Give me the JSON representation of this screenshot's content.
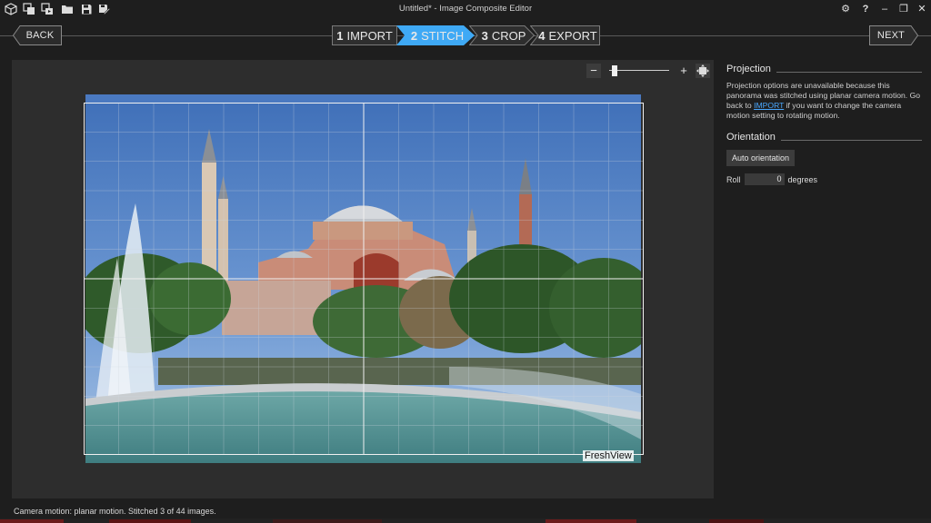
{
  "window": {
    "title": "Untitled* - Image Composite Editor",
    "toolbar_icons": [
      "new-panorama-icon",
      "new-from-images-icon",
      "new-from-video-icon",
      "open-icon",
      "save-icon",
      "save-as-icon"
    ],
    "controls": {
      "settings_icon": "⚙",
      "help": "?",
      "minimize": "–",
      "restore": "❐",
      "close": "✕"
    }
  },
  "nav": {
    "back_label": "BACK",
    "next_label": "NEXT"
  },
  "steps": [
    {
      "num": "1",
      "label": "IMPORT",
      "active": false
    },
    {
      "num": "2",
      "label": "STITCH",
      "active": true
    },
    {
      "num": "3",
      "label": "CROP",
      "active": false
    },
    {
      "num": "4",
      "label": "EXPORT",
      "active": false
    }
  ],
  "zoom": {
    "minus": "−",
    "plus": "+",
    "fit_icon": "fit-to-window-icon",
    "level_fraction": 0.05
  },
  "preview": {
    "watermark": "FreshView"
  },
  "panel": {
    "projection": {
      "heading": "Projection",
      "text_before_link": "Projection options are unavailable because this panorama was stitched using planar camera motion. Go back to ",
      "link_text": "IMPORT",
      "text_after_link": " if you want to change the camera motion setting to rotating motion."
    },
    "orientation": {
      "heading": "Orientation",
      "auto_button": "Auto orientation",
      "roll_label": "Roll",
      "roll_value": "0",
      "roll_unit": "degrees"
    }
  },
  "status": {
    "text": "Camera motion: planar motion. Stitched 3 of 44 images."
  },
  "colors": {
    "accent": "#3fa9f5",
    "background": "#1e1e1e",
    "workspace": "#2d2d2d",
    "link": "#4aa8ff"
  }
}
